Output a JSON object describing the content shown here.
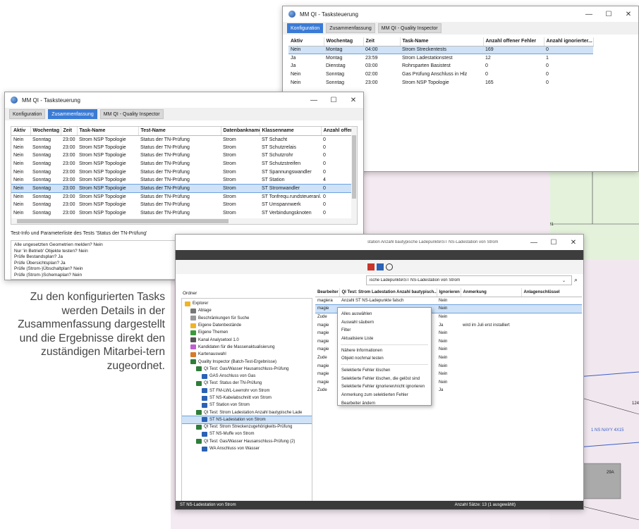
{
  "top_window": {
    "title": "MM QI - Tasksteuerung",
    "controls": [
      "—",
      "☐",
      "✕"
    ],
    "tabs": [
      "Konfiguration",
      "Zusammenfassung",
      "MM QI - Quality Inspector"
    ],
    "active_tab": 0,
    "columns": [
      "Aktiv",
      "Wochentag",
      "Zeit",
      "Task-Name",
      "Anzahl offener Fehler",
      "Anzahl ignorierter..."
    ],
    "rows": [
      [
        "Nein",
        "Montag",
        "04:00",
        "Strom Streckentests",
        "169",
        "0"
      ],
      [
        "Ja",
        "Montag",
        "23:59",
        "Strom Ladestationstest",
        "12",
        "1"
      ],
      [
        "Ja",
        "Dienstag",
        "03:00",
        "Rohrsparten Basistest",
        "0",
        "0"
      ],
      [
        "Nein",
        "Sonntag",
        "02:00",
        "Gas Prüfung Anschluss in Hlz",
        "0",
        "0"
      ],
      [
        "Nein",
        "Sonntag",
        "23:00",
        "Strom NSP Topologie",
        "165",
        "0"
      ]
    ],
    "selected_row": 0
  },
  "left_window": {
    "title": "MM QI - Tasksteuerung",
    "controls": [
      "—",
      "☐",
      "✕"
    ],
    "tabs": [
      "Konfiguration",
      "Zusammenfassung",
      "MM QI - Quality Inspector"
    ],
    "active_tab": 1,
    "columns": [
      "Aktiv",
      "Wochentag",
      "Zeit",
      "Task-Name",
      "Test-Name",
      "Datenbankname",
      "Klassenname",
      "Anzahl offer"
    ],
    "rows": [
      [
        "Nein",
        "Sonntag",
        "23:00",
        "Strom NSP Topologie",
        "Status der TN-Prüfung",
        "Strom",
        "ST Schacht",
        "0"
      ],
      [
        "Nein",
        "Sonntag",
        "23:00",
        "Strom NSP Topologie",
        "Status der TN-Prüfung",
        "Strom",
        "ST Schutzrelais",
        "0"
      ],
      [
        "Nein",
        "Sonntag",
        "23:00",
        "Strom NSP Topologie",
        "Status der TN-Prüfung",
        "Strom",
        "ST Schutzrohr",
        "0"
      ],
      [
        "Nein",
        "Sonntag",
        "23:00",
        "Strom NSP Topologie",
        "Status der TN-Prüfung",
        "Strom",
        "ST Schutzstreifen",
        "0"
      ],
      [
        "Nein",
        "Sonntag",
        "23:00",
        "Strom NSP Topologie",
        "Status der TN-Prüfung",
        "Strom",
        "ST Spannungswandler",
        "0"
      ],
      [
        "Nein",
        "Sonntag",
        "23:00",
        "Strom NSP Topologie",
        "Status der TN-Prüfung",
        "Strom",
        "ST Station",
        "4"
      ],
      [
        "Nein",
        "Sonntag",
        "23:00",
        "Strom NSP Topologie",
        "Status der TN-Prüfung",
        "Strom",
        "ST Stromwandler",
        "0"
      ],
      [
        "Nein",
        "Sonntag",
        "23:00",
        "Strom NSP Topologie",
        "Status der TN-Prüfung",
        "Strom",
        "ST Tonfrequ.rundsteueranl.",
        "0"
      ],
      [
        "Nein",
        "Sonntag",
        "23:00",
        "Strom NSP Topologie",
        "Status der TN-Prüfung",
        "Strom",
        "ST Umspannwerk",
        "0"
      ],
      [
        "Nein",
        "Sonntag",
        "23:00",
        "Strom NSP Topologie",
        "Status der TN-Prüfung",
        "Strom",
        "ST Verbindungsknoten",
        "0"
      ]
    ],
    "selected_row": 6,
    "info_label": "Test-Info und Parameterliste des Tests 'Status der TN-Prüfung'",
    "info_lines": [
      "Alle ungesetzten Geometrien melden?  Nein",
      "Nur 'in Betrieb' Objekte testen?  Nein",
      "Prüfe Bestandsplan?  Ja",
      "Prüfe Übersichtsplan?  Ja",
      "Prüfe (Strom-)Übschaltplan?  Nein",
      "Prüfe (Strom-)Schemaplan?  Nein"
    ]
  },
  "caption": "Zu den konfigurierten Tasks werden Details in der Zusammenfassung dargestellt und die Ergebnisse direkt den zuständigen Mitarbei-tern zugeordnet.",
  "explorer": {
    "title_partial": "station Anzahl bautypische Ladepunkte\\ST NS-Ladestation von Strom",
    "path_partial": "ische Ladepunkte\\ST NS-Ladestation von Strom",
    "tree_header": "Ordner",
    "tree": [
      {
        "label": "Explorer",
        "level": 0,
        "icon": "folder-icon"
      },
      {
        "label": "Ablage",
        "level": 1,
        "icon": "archive-icon"
      },
      {
        "label": "Beschränkungen für Suche",
        "level": 1,
        "icon": "search-icon"
      },
      {
        "label": "Eigene Datenbestände",
        "level": 1,
        "icon": "folder-icon"
      },
      {
        "label": "Eigene Themen",
        "level": 1,
        "icon": "layers-icon"
      },
      {
        "label": "Kanal Analysetool 1.0",
        "level": 1,
        "icon": "tool-icon"
      },
      {
        "label": "Kandidaten für die Massenaktualisierung",
        "level": 1,
        "icon": "list-icon"
      },
      {
        "label": "Kartenauswahl",
        "level": 1,
        "icon": "map-icon"
      },
      {
        "label": "Quality Inspector (Batch-Test-Ergebnisse)",
        "level": 1,
        "icon": "qi-icon"
      },
      {
        "label": "QI Test: Gas/Wasser Hausanschluss-Prüfung",
        "level": 2,
        "icon": "qi-icon"
      },
      {
        "label": "GAS Anschluss von Gas",
        "level": 3,
        "icon": "table-icon"
      },
      {
        "label": "QI Test: Status der TN-Prüfung",
        "level": 2,
        "icon": "qi-icon"
      },
      {
        "label": "ST FM-LWL-Leerrohr von Strom",
        "level": 3,
        "icon": "line-icon"
      },
      {
        "label": "ST NS-Kabelabschnitt von Strom",
        "level": 3,
        "icon": "line-icon"
      },
      {
        "label": "ST Station von Strom",
        "level": 3,
        "icon": "table-icon"
      },
      {
        "label": "QI Test: Strom Ladestation Anzahl bautypische Lade",
        "level": 2,
        "icon": "qi-icon"
      },
      {
        "label": "ST NS-Ladestation von Strom",
        "level": 3,
        "icon": "table-icon"
      },
      {
        "label": "QI Test: Strom Streckenzugehörigkeits-Prüfung",
        "level": 2,
        "icon": "qi-icon"
      },
      {
        "label": "ST NS-Muffe von Strom",
        "level": 3,
        "icon": "line-icon"
      },
      {
        "label": "QI Test: Gas/Wasser Hausanschluss-Prüfung (2)",
        "level": 2,
        "icon": "qi-icon"
      },
      {
        "label": "WA Anschluss von Wasser",
        "level": 3,
        "icon": "table-icon"
      }
    ],
    "selected_tree": 16,
    "grid_columns": [
      "Bearbeiter",
      "QI Test: Strom Ladestation Anzahl bautypisch...",
      "Ignorieren",
      "Anmerkung",
      "Anlagenschlüssel"
    ],
    "grid_rows": [
      [
        "magiera",
        "Anzahl ST NS-Ladepunkte falsch",
        "Nein",
        ""
      ],
      [
        "magie",
        "",
        "Nein",
        ""
      ],
      [
        "Zude",
        "",
        "Nein",
        ""
      ],
      [
        "magie",
        "",
        "Ja",
        "wird im Juli erst installiert"
      ],
      [
        "magie",
        "",
        "Nein",
        ""
      ],
      [
        "magie",
        "",
        "Nein",
        ""
      ],
      [
        "magie",
        "",
        "Nein",
        ""
      ],
      [
        "Zude",
        "",
        "Nein",
        ""
      ],
      [
        "magie",
        "",
        "Nein",
        ""
      ],
      [
        "magie",
        "",
        "Nein",
        ""
      ],
      [
        "magie",
        "",
        "Nein",
        ""
      ],
      [
        "Zude",
        "",
        "Ja",
        ""
      ]
    ],
    "context_menu": [
      "Alles auswählen",
      "Auswahl säubern",
      "Filter",
      "Aktualisiere Liste",
      "Nähere Informationen",
      "Objekt nochmal testen",
      "Selektierte Fehler löschen",
      "Selektierte Fehler löschen, die gelöst sind",
      "Selektierte Fehler ignorieren/nicht ignorieren",
      "Anmerkung zum selektierten Fehler",
      "Bearbeiter ändern"
    ],
    "status_left": "ST NS-Ladestation von Strom",
    "status_right": "Anzahl Sätze: 13 (1 ausgewählt)"
  },
  "map_labels": [
    "21",
    "4",
    "2",
    "124",
    "6",
    "1 NS NAYY 4X15",
    "29A",
    "2A",
    "NAYY 4X50",
    "NAYY 4X35"
  ]
}
